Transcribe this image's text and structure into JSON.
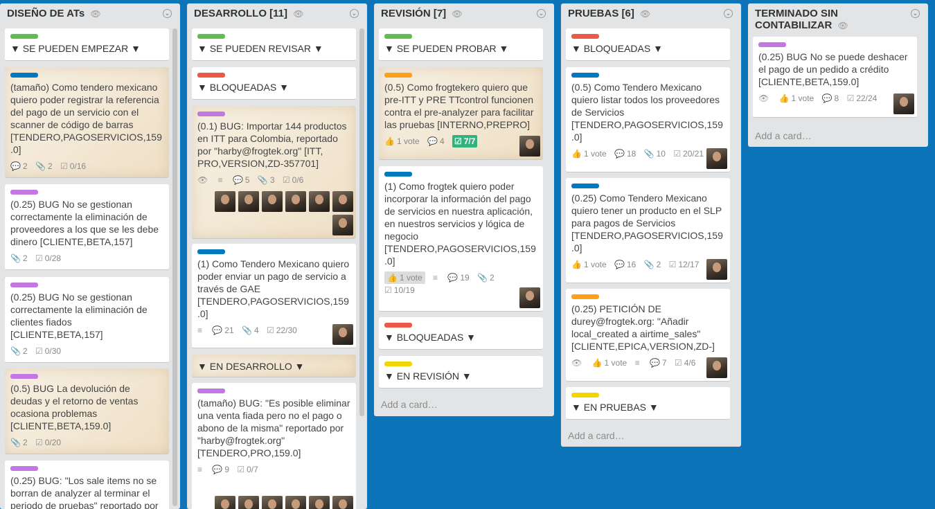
{
  "lists": [
    {
      "title": "DISEÑO DE ATs",
      "cards": [
        {
          "title": "▼ SE PUEDEN EMPEZAR ▼",
          "label": "#61bd4f"
        },
        {
          "title": "(tamaño) Como tendero mexicano quiero poder registrar la referencia del pago de un servicio con el scanner de código de barras [TENDERO,PAGOSERVICIOS,159.0]",
          "label": "#0079bf",
          "badges": [
            "2",
            "2",
            "0/16"
          ]
        },
        {
          "title": "(0.25) BUG No se gestionan correctamente la eliminación de proveedores a los que se les debe dinero [CLIENTE,BETA,157]",
          "label": "#c377e0",
          "badges": [
            "2",
            "0/28"
          ]
        },
        {
          "title": "(0.25) BUG No se gestionan correctamente la eliminación de clientes fiados [CLIENTE,BETA,157]",
          "label": "#c377e0",
          "badges": [
            "2",
            "0/30"
          ]
        },
        {
          "title": "(0.5) BUG La devolución de deudas y el retorno de ventas ocasiona problemas [CLIENTE,BETA,159.0]",
          "label": "#c377e0",
          "badges": [
            "2",
            "0/20"
          ]
        },
        {
          "title": "(0.25) BUG: \"Los sale items no se borran de analyzer al terminar el periodo de pruebas\" reportado por",
          "label": "#c377e0"
        }
      ]
    },
    {
      "title": "DESARROLLO [11]",
      "cards": [
        {
          "title": "▼ SE PUEDEN REVISAR ▼",
          "label": "#61bd4f"
        },
        {
          "title": "▼ BLOQUEADAS ▼",
          "label": "#eb5a46"
        },
        {
          "title": "(0.1) BUG: Importar 144 productos en ITT para Colombia, reportado por \"harby@frogtek.org\" [ITT, PRO,VERSION,ZD-357701]",
          "label": "#c377e0",
          "badges": [
            "5",
            "3",
            "0/6"
          ]
        },
        {
          "title": "(1) Como Tendero Mexicano quiero poder enviar un pago de servicio a través de GAE [TENDERO,PAGOSERVICIOS,159.0]",
          "label": "#0079bf",
          "badges": [
            "21",
            "4",
            "22/30"
          ]
        },
        {
          "title": "▼ EN DESARROLLO ▼"
        },
        {
          "title": "(tamaño) BUG: \"Es posible eliminar una venta fiada pero no el pago o abono de la misma\" reportado por \"harby@frogtek.org\" [TENDERO,PRO,159.0]",
          "label": "#c377e0",
          "badges": [
            "9",
            "0/7"
          ]
        }
      ]
    },
    {
      "title": "REVISIÓN [7]",
      "add": "Add a card…",
      "cards": [
        {
          "title": "▼ SE PUEDEN PROBAR ▼",
          "label": "#61bd4f"
        },
        {
          "title": "(0.5) Como frogtekero quiero que pre-ITT y PRE TTcontrol funcionen contra el pre-analyzer para facilitar las pruebas [INTERNO,PREPRO]",
          "label": "#ff9f1a",
          "badges": [
            "1 vote",
            "4",
            "7/7"
          ]
        },
        {
          "title": "(1) Como frogtek quiero poder incorporar la información del pago de servicios en nuestra aplicación, en nuestros servicios y lógica de negocio [TENDERO,PAGOSERVICIOS,159.0]",
          "label": "#0079bf",
          "badges": [
            "1 vote",
            "19",
            "2",
            "10/19"
          ]
        },
        {
          "title": "▼ BLOQUEADAS ▼",
          "label": "#eb5a46"
        },
        {
          "title": "▼ EN REVISIÓN ▼",
          "label": "#f2d600"
        }
      ]
    },
    {
      "title": "PRUEBAS [6]",
      "add": "Add a card…",
      "cards": [
        {
          "title": "▼ BLOQUEADAS ▼",
          "label": "#eb5a46"
        },
        {
          "title": "(0.5) Como Tendero Mexicano quiero listar todos los proveedores de Servicios [TENDERO,PAGOSERVICIOS,159.0]",
          "label": "#0079bf",
          "badges": [
            "1 vote",
            "18",
            "10",
            "20/21"
          ]
        },
        {
          "title": "(0.25) Como Tendero Mexicano quiero tener un producto en el SLP para pagos de Servicios [TENDERO,PAGOSERVICIOS,159.0]",
          "label": "#0079bf",
          "badges": [
            "1 vote",
            "16",
            "2",
            "12/17"
          ]
        },
        {
          "title": "(0.25) PETICIÓN DE durey@frogtek.org: \"Añadir local_created a airtime_sales\" [CLIENTE,EPICA,VERSION,ZD-]",
          "label": "#ff9f1a",
          "badges": [
            "1 vote",
            "7",
            "4/6"
          ]
        },
        {
          "title": "▼ EN PRUEBAS ▼",
          "label": "#f2d600"
        }
      ]
    },
    {
      "title": "TERMINADO SIN CONTABILIZAR",
      "add": "Add a card…",
      "cards": [
        {
          "title": "(0.25) BUG No se puede deshacer el pago de un pedido a crédito [CLIENTE,BETA,159.0]",
          "label": "#c377e0",
          "badges": [
            "1 vote",
            "8",
            "22/24"
          ]
        }
      ]
    }
  ]
}
